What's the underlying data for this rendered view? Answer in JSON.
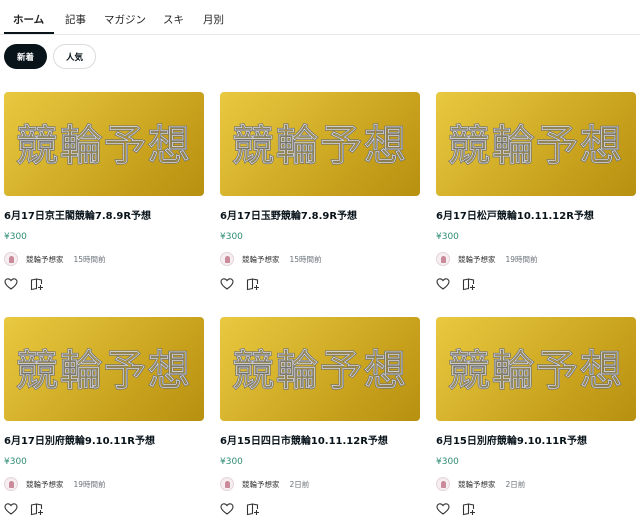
{
  "tabs": [
    {
      "label": "ホーム",
      "active": true
    },
    {
      "label": "記事"
    },
    {
      "label": "マガジン"
    },
    {
      "label": "スキ"
    },
    {
      "label": "月別"
    }
  ],
  "filters": {
    "new": "新着",
    "popular": "人気"
  },
  "thumbnail_text": "競輪予想",
  "accent_color": "#2e8c73",
  "cards": [
    {
      "title": "6月17日京王閣競輪7.8.9R予想",
      "price": "¥300",
      "author": "競輪予想家",
      "time": "15時間前"
    },
    {
      "title": "6月17日玉野競輪7.8.9R予想",
      "price": "¥300",
      "author": "競輪予想家",
      "time": "15時間前"
    },
    {
      "title": "6月17日松戸競輪10.11.12R予想",
      "price": "¥300",
      "author": "競輪予想家",
      "time": "19時間前"
    },
    {
      "title": "6月17日別府競輪9.10.11R予想",
      "price": "¥300",
      "author": "競輪予想家",
      "time": "19時間前"
    },
    {
      "title": "6月15日四日市競輪10.11.12R予想",
      "price": "¥300",
      "author": "競輪予想家",
      "time": "2日前"
    },
    {
      "title": "6月15日別府競輪9.10.11R予想",
      "price": "¥300",
      "author": "競輪予想家",
      "time": "2日前"
    }
  ],
  "icons": {
    "like": "heart-icon",
    "save": "magazine-add-icon"
  }
}
